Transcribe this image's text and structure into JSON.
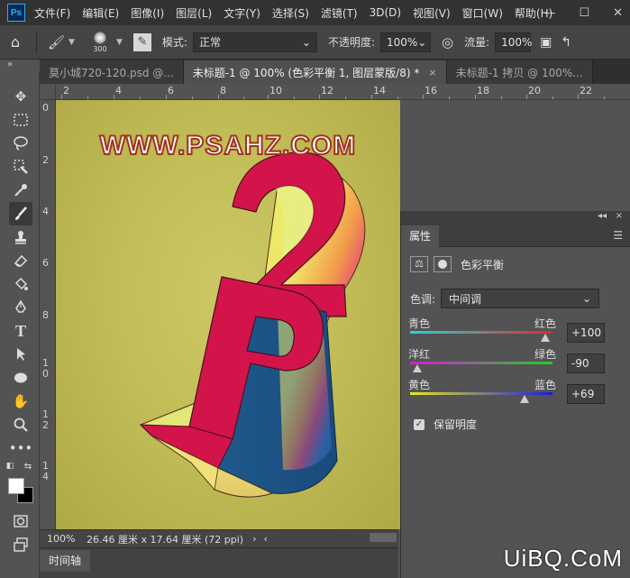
{
  "menu": {
    "logo": "Ps",
    "items": [
      "文件(F)",
      "编辑(E)",
      "图像(I)",
      "图层(L)",
      "文字(Y)",
      "选择(S)",
      "滤镜(T)",
      "3D(D)",
      "视图(V)",
      "窗口(W)",
      "帮助(H)"
    ],
    "window_controls": [
      "—",
      "☐",
      "✕"
    ]
  },
  "options": {
    "brush_size": "300",
    "mode_label": "模式:",
    "mode_value": "正常",
    "opacity_label": "不透明度:",
    "opacity_value": "100%",
    "flow_label": "流量:",
    "flow_value": "100%"
  },
  "tabs": {
    "collapse": "»",
    "items": [
      {
        "label": "莫小城720-120.psd @...",
        "active": false
      },
      {
        "label": "未标题-1 @ 100% (色彩平衡 1, 图层蒙版/8) *",
        "active": true
      },
      {
        "label": "未标题-1 拷贝 @ 100%...",
        "active": false
      }
    ],
    "close": "×"
  },
  "rulers": {
    "top": [
      "2",
      "4",
      "6",
      "8",
      "10",
      "12",
      "14",
      "16",
      "18",
      "20",
      "22"
    ],
    "left": [
      "0",
      "2",
      "4",
      "6",
      "8",
      "1 0",
      "1 2",
      "1 4"
    ]
  },
  "canvas": {
    "watermark": "WWW.PSAHZ.COM",
    "bg_color": "#c2be59",
    "letter_red": "#d2144a",
    "letter_blue": "#1f5a8c"
  },
  "status": {
    "zoom": "100%",
    "dims": "26.46 厘米 x 17.64 厘米 (72 ppi)",
    "chev": "›",
    "chev2": "‹"
  },
  "timeline": {
    "tab": "时间轴"
  },
  "properties": {
    "tab": "属性",
    "menu": "☰",
    "collapse": "◂◂",
    "close": "×",
    "adjustment": "色彩平衡",
    "tone_label": "色调:",
    "tone_value": "中间调",
    "sliders": [
      {
        "left": "青色",
        "right": "红色",
        "value": "+100",
        "position": 1.0,
        "track": "linear-gradient(90deg,#22d3e0,#e02a2a)"
      },
      {
        "left": "洋红",
        "right": "绿色",
        "value": "-90",
        "position": 0.05,
        "track": "linear-gradient(90deg,#d81ad8,#1fd11f)"
      },
      {
        "left": "黄色",
        "right": "蓝色",
        "value": "+69",
        "position": 0.845,
        "track": "linear-gradient(90deg,#e8e81a,#1a1ae8)"
      }
    ],
    "preserve_label": "保留明度",
    "preserve_checked": "✓"
  },
  "site_mark": "UiBQ.CoM"
}
